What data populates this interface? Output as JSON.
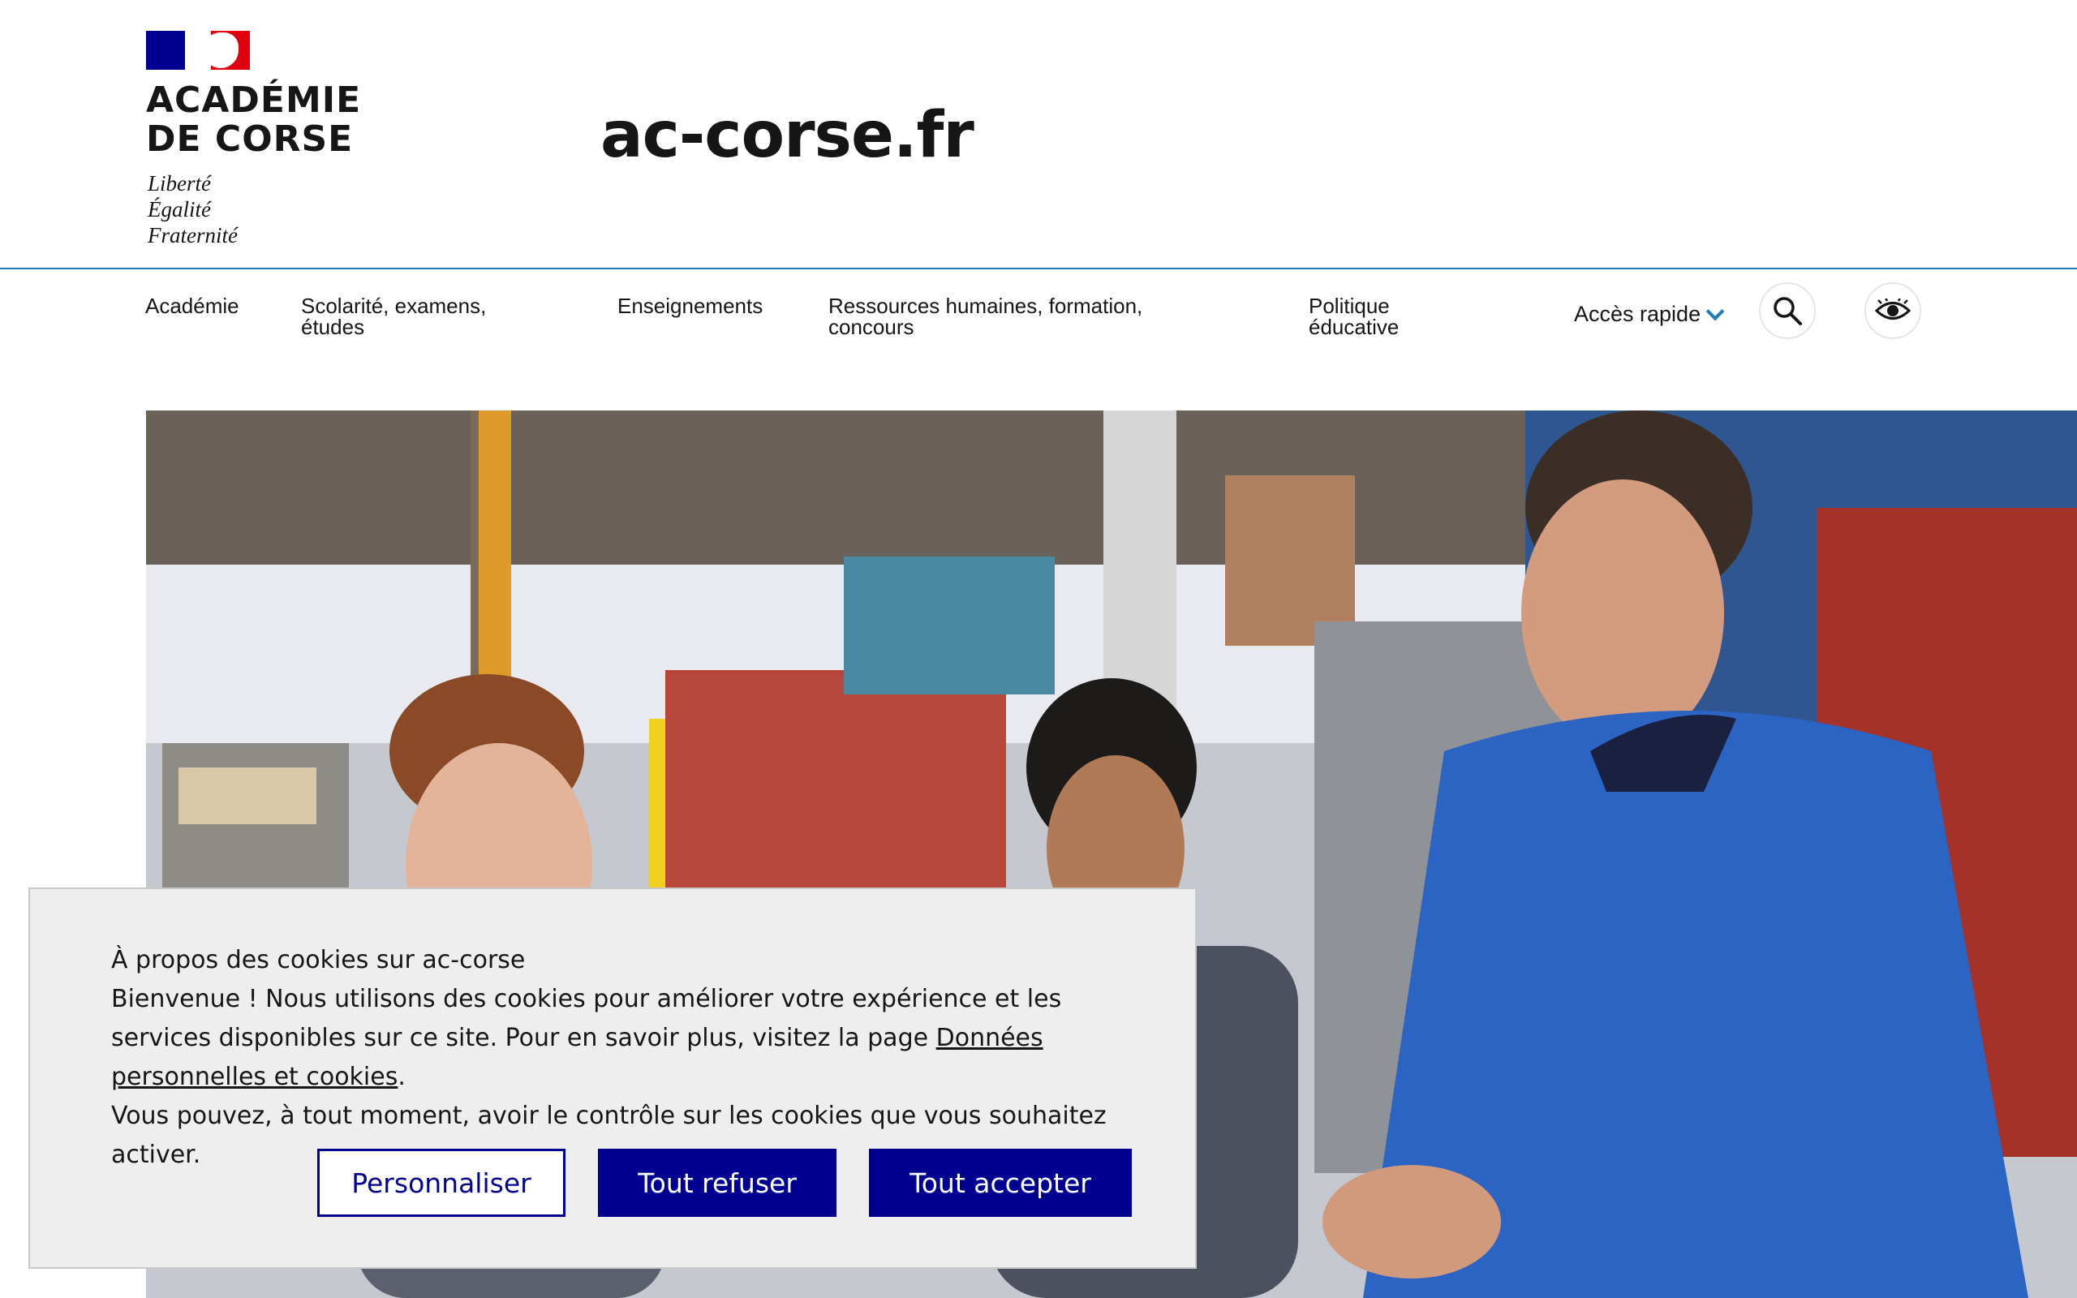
{
  "header": {
    "logo_name": "ACADÉMIE\nDE CORSE",
    "logo_motto": "Liberté\nÉgalité\nFraternité",
    "site_name": "ac-corse.fr"
  },
  "nav": {
    "items": [
      {
        "label": "Académie"
      },
      {
        "label_line1": "Scolarité, examens,",
        "label_line2": "études"
      },
      {
        "label": "Enseignements"
      },
      {
        "label_line1": "Ressources humaines, formation,",
        "label_line2": "concours"
      },
      {
        "label_line1": "Politique",
        "label_line2": "éducative"
      }
    ],
    "quick_access_label": "Accès rapide",
    "search_icon": "search-icon",
    "accessibility_icon": "eye-icon"
  },
  "hero": {
    "image": "workshop-photo"
  },
  "cookie_banner": {
    "title": "À propos des cookies sur ac-corse",
    "body_part1": "Bienvenue ! Nous utilisons des cookies pour améliorer votre expérience et les services disponibles sur ce site. Pour en savoir plus, visitez la page ",
    "link_label": "Données personnelles et cookies",
    "body_part2": ".",
    "body_line3": "Vous pouvez, à tout moment, avoir le contrôle sur les cookies que vous souhaitez activer.",
    "buttons": {
      "customize": "Personnaliser",
      "refuse": "Tout refuser",
      "accept": "Tout accepter"
    }
  },
  "colors": {
    "brand_blue": "#000091",
    "accent_blue": "#1f7dba",
    "marianne_red": "#e1000f"
  }
}
